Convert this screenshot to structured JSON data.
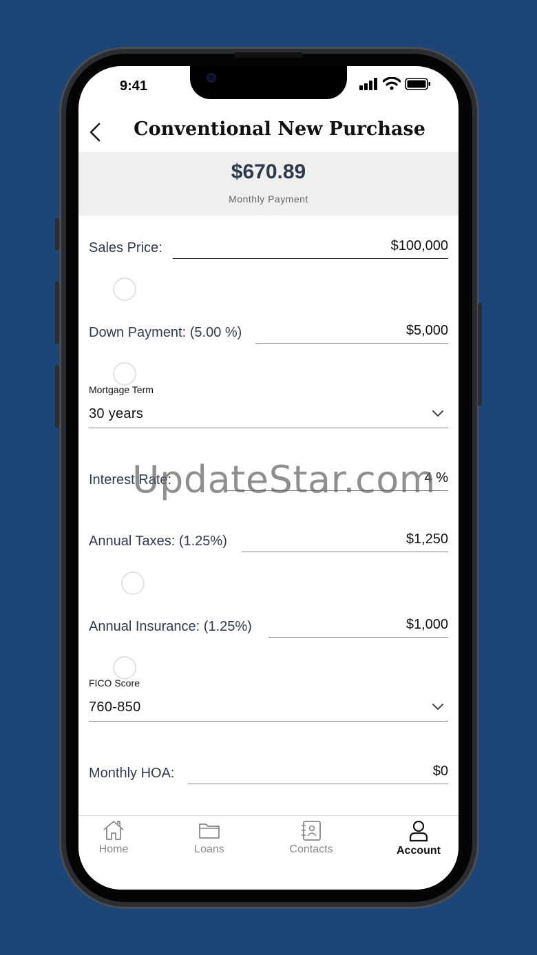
{
  "status_bar": {
    "time": "9:41"
  },
  "header": {
    "title": "Conventional New Purchase"
  },
  "summary": {
    "amount": "$670.89",
    "label": "Monthly Payment"
  },
  "fields": {
    "sales_price": {
      "label": "Sales Price:",
      "value": "$100,000"
    },
    "down_payment": {
      "label": "Down Payment:  (5.00 %)",
      "value": "$5,000"
    },
    "mortgage_term": {
      "caption": "Mortgage Term",
      "value": "30 years"
    },
    "interest_rate": {
      "label": "Interest Rate:",
      "value": "4 %"
    },
    "annual_taxes": {
      "label": "Annual Taxes:  (1.25%)",
      "value": "$1,250"
    },
    "annual_insurance": {
      "label": "Annual Insurance:  (1.25%)",
      "value": "$1,000"
    },
    "fico_score": {
      "caption": "FICO Score",
      "value": "760-850"
    },
    "monthly_hoa": {
      "label": "Monthly HOA:",
      "value": "$0"
    }
  },
  "watermark": "UpdateStar.com",
  "tabs": [
    {
      "label": "Home",
      "icon": "home-icon"
    },
    {
      "label": "Loans",
      "icon": "folder-icon"
    },
    {
      "label": "Contacts",
      "icon": "contacts-icon"
    },
    {
      "label": "Account",
      "icon": "person-icon",
      "active": true
    }
  ],
  "colors": {
    "background": "#1c4678",
    "summary_bg": "#efefef",
    "active_tab": "#111111",
    "inactive_tab": "#888888"
  }
}
